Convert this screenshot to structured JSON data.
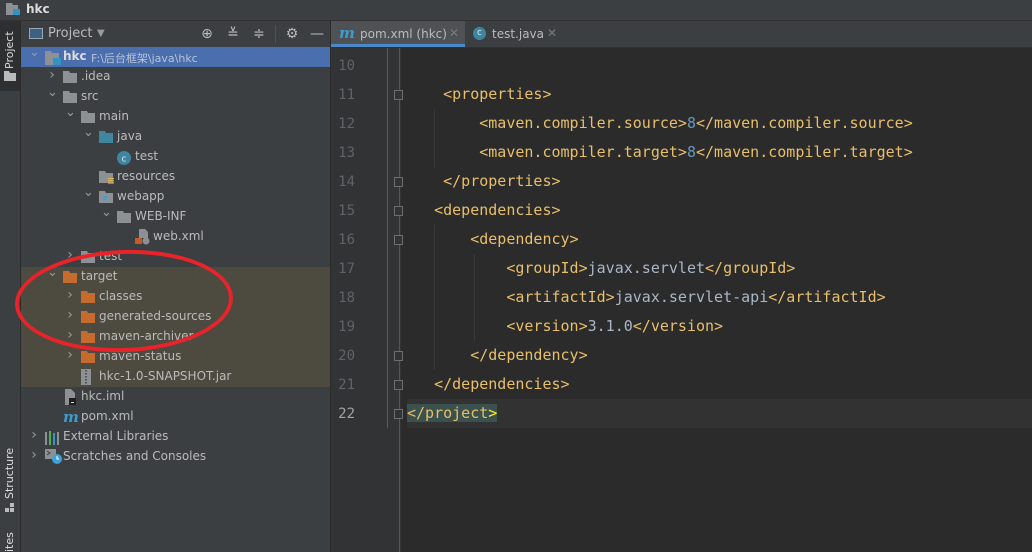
{
  "window": {
    "title": "hkc"
  },
  "left_strip": {
    "tabs": [
      {
        "label": "Project",
        "active": true
      },
      {
        "label": "Structure"
      },
      {
        "label": "ites"
      }
    ]
  },
  "project_panel": {
    "view_label": "Project",
    "icons": [
      "locate-icon",
      "expand-all-icon",
      "collapse-all-icon",
      "gear-icon",
      "minimize-icon"
    ],
    "tree": [
      {
        "label": "hkc",
        "path": "F:\\后台框架\\java\\hkc",
        "depth": 0,
        "expanded": true,
        "icon": "module",
        "selected": true
      },
      {
        "label": ".idea",
        "depth": 1,
        "expanded": false,
        "icon": "folder"
      },
      {
        "label": "src",
        "depth": 1,
        "expanded": true,
        "icon": "folder"
      },
      {
        "label": "main",
        "depth": 2,
        "expanded": true,
        "icon": "folder"
      },
      {
        "label": "java",
        "depth": 3,
        "expanded": true,
        "icon": "folder-blue"
      },
      {
        "label": "test",
        "depth": 4,
        "icon": "class"
      },
      {
        "label": "resources",
        "depth": 3,
        "icon": "resources"
      },
      {
        "label": "webapp",
        "depth": 3,
        "expanded": true,
        "icon": "web"
      },
      {
        "label": "WEB-INF",
        "depth": 4,
        "expanded": true,
        "icon": "folder"
      },
      {
        "label": "web.xml",
        "depth": 5,
        "icon": "webxml"
      },
      {
        "label": "test",
        "depth": 2,
        "expanded": false,
        "icon": "folder"
      },
      {
        "label": "target",
        "depth": 1,
        "expanded": true,
        "icon": "folder-orange",
        "excluded": true
      },
      {
        "label": "classes",
        "depth": 2,
        "expanded": false,
        "icon": "folder-orange",
        "excluded": true
      },
      {
        "label": "generated-sources",
        "depth": 2,
        "expanded": false,
        "icon": "folder-orange",
        "excluded": true
      },
      {
        "label": "maven-archiver",
        "depth": 2,
        "expanded": false,
        "icon": "folder-orange",
        "excluded": true
      },
      {
        "label": "maven-status",
        "depth": 2,
        "expanded": false,
        "icon": "folder-orange",
        "excluded": true
      },
      {
        "label": "hkc-1.0-SNAPSHOT.jar",
        "depth": 2,
        "icon": "jar",
        "excluded": true
      },
      {
        "label": "hkc.iml",
        "depth": 1,
        "icon": "iml"
      },
      {
        "label": "pom.xml",
        "depth": 1,
        "icon": "maven"
      },
      {
        "label": "External Libraries",
        "depth": 0,
        "expanded": false,
        "icon": "libraries"
      },
      {
        "label": "Scratches and Consoles",
        "depth": 0,
        "expanded": false,
        "icon": "scratches"
      }
    ]
  },
  "editor": {
    "tabs": [
      {
        "label": "pom.xml (hkc)",
        "icon": "maven",
        "active": true
      },
      {
        "label": "test.java",
        "icon": "class",
        "active": false
      }
    ],
    "lines": [
      {
        "n": "10",
        "code": ""
      },
      {
        "n": "11",
        "code": "    <properties>"
      },
      {
        "n": "12",
        "code": "        <maven.compiler.source>8</maven.compiler.source>"
      },
      {
        "n": "13",
        "code": "        <maven.compiler.target>8</maven.compiler.target>"
      },
      {
        "n": "14",
        "code": "    </properties>"
      },
      {
        "n": "15",
        "code": "   <dependencies>"
      },
      {
        "n": "16",
        "code": "       <dependency>"
      },
      {
        "n": "17",
        "code": "           <groupId>javax.servlet</groupId>"
      },
      {
        "n": "18",
        "code": "           <artifactId>javax.servlet-api</artifactId>"
      },
      {
        "n": "19",
        "code": "           <version>3.1.0</version>"
      },
      {
        "n": "20",
        "code": "       </dependency>"
      },
      {
        "n": "21",
        "code": "   </dependencies>"
      },
      {
        "n": "22",
        "code": "</project>",
        "current": true
      }
    ]
  },
  "annotation": {
    "shape": "red-ellipse",
    "color": "#e8242a"
  }
}
